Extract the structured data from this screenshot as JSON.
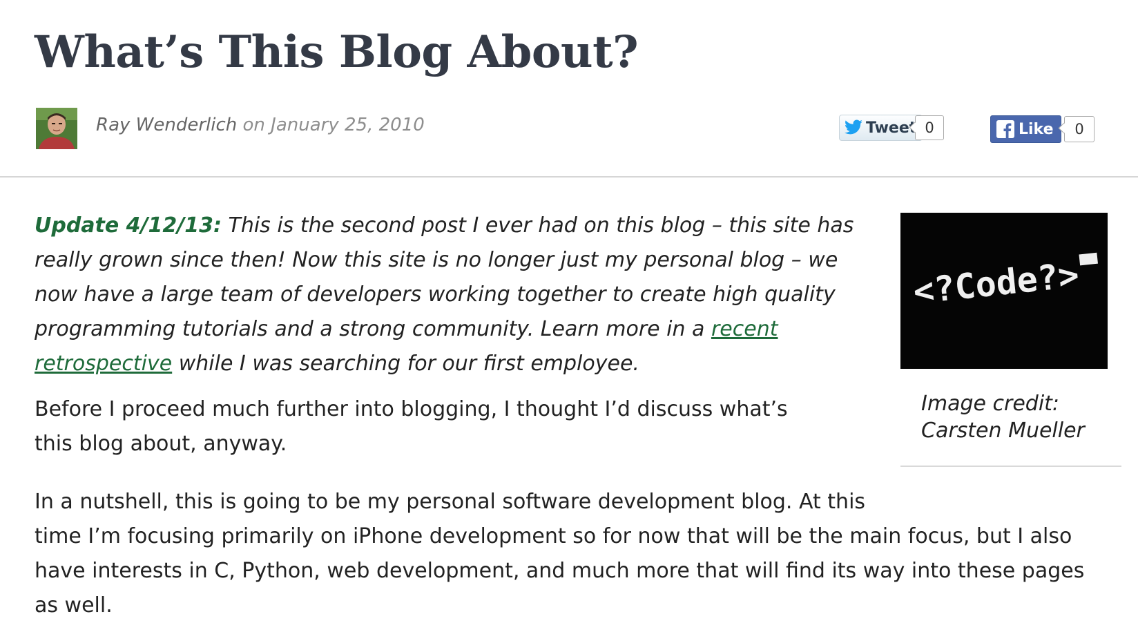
{
  "article": {
    "title": "What’s This Blog About?",
    "author": "Ray Wenderlich",
    "date_prefix": " on ",
    "date": "January 25, 2010"
  },
  "social": {
    "tweet_label": "Tweet",
    "tweet_count": "0",
    "like_label": "Like",
    "like_count": "0"
  },
  "update_note": {
    "label": "Update 4/12/13:",
    "text_before_link": " This is the second post I ever had on this blog – this site has really grown since then! Now this site is no longer just my personal blog – we now have a large team of developers working together to create high quality programming tutorials and a strong community. Learn more in a ",
    "link_text": "recent retrospective",
    "text_after_link": " while I was searching for our first employee."
  },
  "paragraphs": {
    "p1": "Before I proceed much further into blogging, I thought I’d discuss what’s this blog about, anyway.",
    "p2_line1": "In a nutshell, this is going to be my personal software development blog. At this",
    "p2_rest": "time I’m focusing primarily on iPhone development so for now that will be the main focus, but I also have interests in C, Python, web development, and much more that will find its way into these pages as well."
  },
  "sidebar": {
    "image_text": "<?Code?>",
    "caption_line1": "Image credit:",
    "caption_line2": "Carsten Mueller"
  },
  "colors": {
    "link_green": "#1e6b3a",
    "title": "#343a46",
    "facebook_blue": "#4a67ad",
    "twitter_blue": "#1da1f2"
  }
}
